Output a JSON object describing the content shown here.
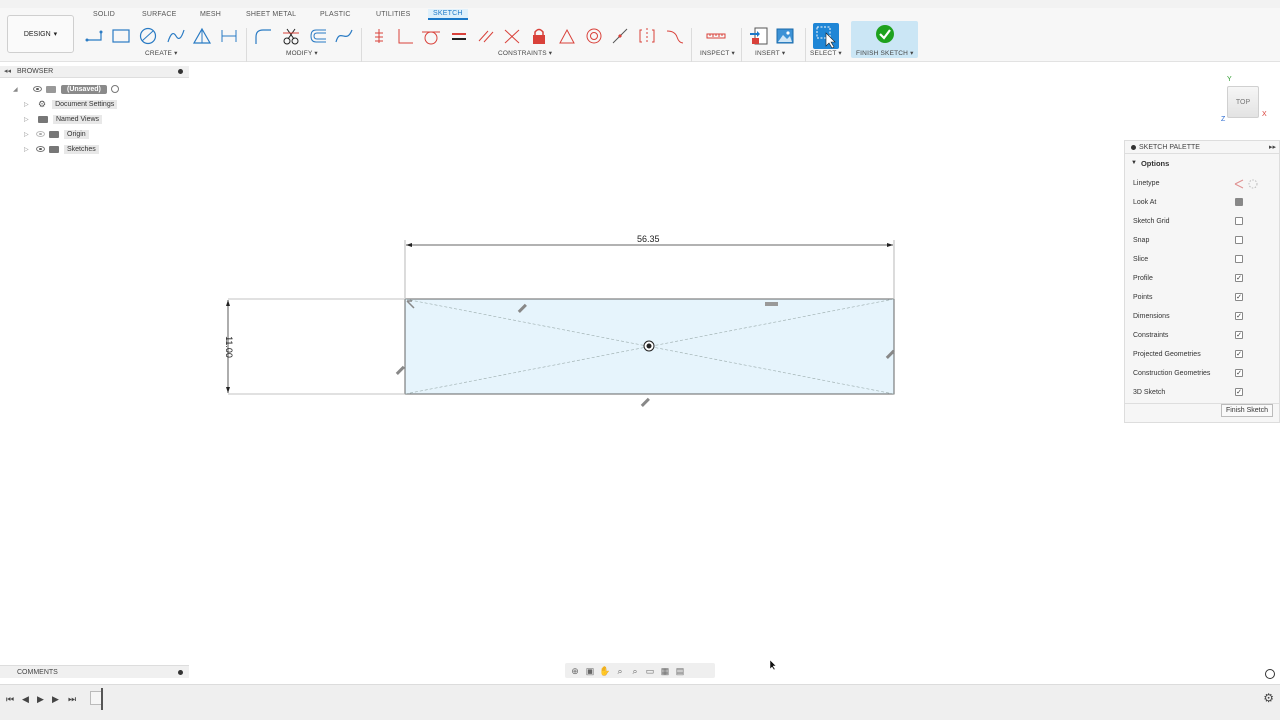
{
  "ribbon": {
    "design_label": "DESIGN",
    "tabs": [
      "SOLID",
      "SURFACE",
      "MESH",
      "SHEET METAL",
      "PLASTIC",
      "UTILITIES",
      "SKETCH"
    ],
    "active_tab": "SKETCH",
    "groups": {
      "create": "CREATE",
      "modify": "MODIFY",
      "constraints": "CONSTRAINTS",
      "inspect": "INSPECT",
      "insert": "INSERT",
      "select": "SELECT",
      "finish": "FINISH SKETCH"
    }
  },
  "browser": {
    "title": "BROWSER",
    "root": "(Unsaved)",
    "items": [
      "Document Settings",
      "Named Views",
      "Origin",
      "Sketches"
    ]
  },
  "sketch": {
    "width_dimension": "56.35",
    "height_dimension": "11.00"
  },
  "viewcube": {
    "face": "TOP",
    "axis_y": "Y",
    "axis_x": "X",
    "axis_z": "Z"
  },
  "palette": {
    "title": "SKETCH PALETTE",
    "options_label": "Options",
    "rows": [
      {
        "label": "Linetype",
        "checked": null
      },
      {
        "label": "Look At",
        "checked": null
      },
      {
        "label": "Sketch Grid",
        "checked": false
      },
      {
        "label": "Snap",
        "checked": false
      },
      {
        "label": "Slice",
        "checked": false
      },
      {
        "label": "Profile",
        "checked": true
      },
      {
        "label": "Points",
        "checked": true
      },
      {
        "label": "Dimensions",
        "checked": true
      },
      {
        "label": "Constraints",
        "checked": true
      },
      {
        "label": "Projected Geometries",
        "checked": true
      },
      {
        "label": "Construction Geometries",
        "checked": true
      },
      {
        "label": "3D Sketch",
        "checked": true
      }
    ],
    "finish_button": "Finish Sketch"
  },
  "comments": {
    "title": "COMMENTS"
  },
  "colors": {
    "accent": "#1b78c8",
    "sketch_fill": "#e6f4fc",
    "constraint_red": "#d9413a"
  }
}
